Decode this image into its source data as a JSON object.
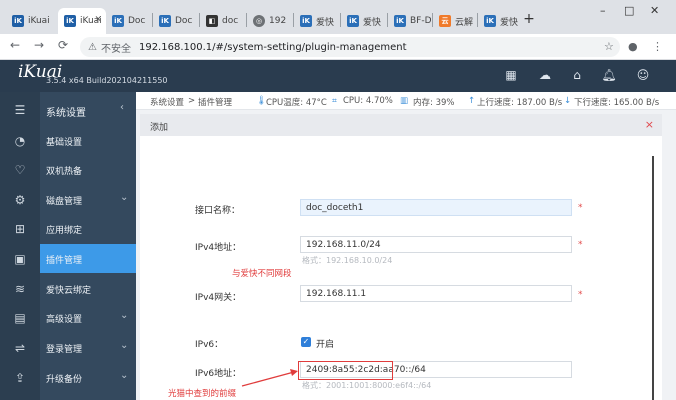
{
  "browser": {
    "tabs": [
      {
        "label": "iKuai",
        "favicon": "ikuai-icon",
        "color": "#1f5fa6",
        "active": false
      },
      {
        "label": "iKuai",
        "favicon": "ikuai-icon",
        "color": "#1f5fa6",
        "active": true
      },
      {
        "label": "Doc",
        "favicon": "ikuai-icon",
        "color": "#2b6fb8",
        "active": false
      },
      {
        "label": "Doc",
        "favicon": "ikuai-icon",
        "color": "#2b6fb8",
        "active": false
      },
      {
        "label": "doc",
        "favicon": "docker-icon",
        "color": "#333333",
        "active": false
      },
      {
        "label": "192",
        "favicon": "globe-icon",
        "color": "#6d7175",
        "active": false
      },
      {
        "label": "爱快",
        "favicon": "ikuai-icon",
        "color": "#2b6fb8",
        "active": false
      },
      {
        "label": "爱快",
        "favicon": "ikuai-icon",
        "color": "#2b6fb8",
        "active": false
      },
      {
        "label": "BF-D",
        "favicon": "ikuai-icon",
        "color": "#2b6fb8",
        "active": false
      },
      {
        "label": "云解",
        "favicon": "cloud-icon",
        "color": "#f07a2a",
        "active": false
      },
      {
        "label": "爱快",
        "favicon": "ikuai-icon",
        "color": "#2b6fb8",
        "active": false
      }
    ],
    "new_tab": "+",
    "window_controls": [
      "–",
      "□",
      "✕"
    ],
    "not_secure": "不安全",
    "url": "192.168.100.1/#/system-setting/plugin-management"
  },
  "app": {
    "logo": "iKuai",
    "build": "3.5.4 x64 Build202104211550"
  },
  "sidebar": {
    "header": "系统设置",
    "items": [
      {
        "label": "基础设置",
        "icon": "gauge-icon",
        "chevron": false,
        "active": false
      },
      {
        "label": "双机热备",
        "icon": "heartbeat-icon",
        "chevron": false,
        "active": false
      },
      {
        "label": "磁盘管理",
        "icon": "gear-icon",
        "chevron": true,
        "active": false
      },
      {
        "label": "应用绑定",
        "icon": "network-icon",
        "chevron": false,
        "active": false
      },
      {
        "label": "插件管理",
        "icon": "plugin-icon",
        "chevron": false,
        "active": true
      },
      {
        "label": "爱快云绑定",
        "icon": "wifi-icon",
        "chevron": false,
        "active": false
      },
      {
        "label": "高级设置",
        "icon": "settings-panel-icon",
        "chevron": true,
        "active": false
      },
      {
        "label": "登录管理",
        "icon": "sliders-icon",
        "chevron": true,
        "active": false
      },
      {
        "label": "升级备份",
        "icon": "upgrade-icon",
        "chevron": true,
        "active": false
      }
    ]
  },
  "breadcrumb": {
    "parent": "系统设置",
    "sep": ">",
    "current": "插件管理",
    "cpu_temp": "CPU温度: 47°C",
    "cpu": "CPU: 4.70%",
    "mem": "内存: 39%",
    "up": "上行速度: 187.00 B/s",
    "down": "下行速度: 165.00 B/s"
  },
  "dialog": {
    "title": "添加",
    "close": "×",
    "fields": {
      "iface_label": "接口名称：",
      "iface_value": "doc_doceth1",
      "ipv4_label": "IPv4地址：",
      "ipv4_value": "192.168.11.0/24",
      "ipv4_hint": "格式：192.168.10.0/24",
      "ipv4_note": "与爱快不同网段",
      "gw_label": "IPv4网关：",
      "gw_value": "192.168.11.1",
      "ipv6_label": "IPv6：",
      "ipv6_check": "开启",
      "ipv6addr_label": "IPv6地址：",
      "ipv6addr_value": "2409:8a55:2c2d:aa70::/64",
      "ipv6addr_hint": "格式：2001:1001:8000:e6f4::/64",
      "ipv6_note": "光猫中查到的前缀",
      "required": "*"
    }
  }
}
